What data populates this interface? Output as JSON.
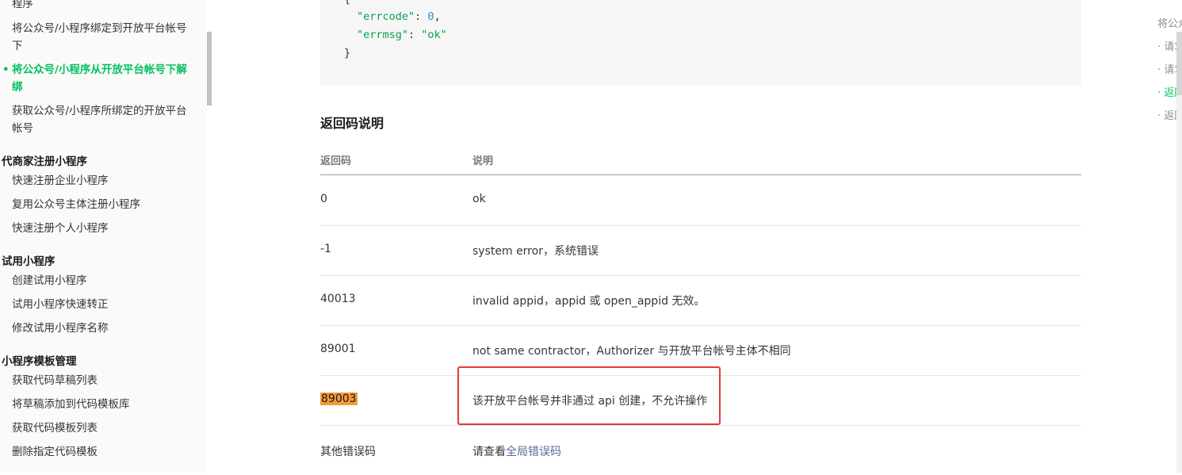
{
  "sidebar": {
    "items": [
      {
        "label": "程序",
        "type": "item"
      },
      {
        "label": "将公众号/小程序绑定到开放平台帐号下",
        "type": "item"
      },
      {
        "label": "将公众号/小程序从开放平台帐号下解绑",
        "type": "active"
      },
      {
        "label": "获取公众号/小程序所绑定的开放平台帐号",
        "type": "item"
      },
      {
        "label": "代商家注册小程序",
        "type": "group"
      },
      {
        "label": "快速注册企业小程序",
        "type": "item"
      },
      {
        "label": "复用公众号主体注册小程序",
        "type": "item"
      },
      {
        "label": "快速注册个人小程序",
        "type": "item"
      },
      {
        "label": "试用小程序",
        "type": "group"
      },
      {
        "label": "创建试用小程序",
        "type": "item"
      },
      {
        "label": "试用小程序快速转正",
        "type": "item"
      },
      {
        "label": "修改试用小程序名称",
        "type": "item"
      },
      {
        "label": "小程序模板管理",
        "type": "group"
      },
      {
        "label": "获取代码草稿列表",
        "type": "item"
      },
      {
        "label": "将草稿添加到代码模板库",
        "type": "item"
      },
      {
        "label": "获取代码模板列表",
        "type": "item"
      },
      {
        "label": "删除指定代码模板",
        "type": "item"
      }
    ]
  },
  "code": {
    "open_brace": "{",
    "key1": "\"errcode\"",
    "val1": "0",
    "key2": "\"errmsg\"",
    "val2": "\"ok\"",
    "close_brace": "}"
  },
  "section_title": "返回码说明",
  "table": {
    "headers": {
      "code": "返回码",
      "desc": "说明"
    },
    "rows": [
      {
        "code": "0",
        "desc": "ok"
      },
      {
        "code": "-1",
        "desc": "system error，系统错误"
      },
      {
        "code": "40013",
        "desc": "invalid appid，appid 或 open_appid 无效。"
      },
      {
        "code": "89001",
        "desc": "not same contractor，Authorizer 与开放平台帐号主体不相同"
      },
      {
        "code": "89003",
        "desc": "该开放平台帐号并非通过 api 创建，不允许操作"
      },
      {
        "code": "其他错误码",
        "desc_prefix": "请查看",
        "desc_link": "全局错误码"
      }
    ]
  },
  "toc": {
    "items": [
      {
        "label": "将公众"
      },
      {
        "label": "· 请求"
      },
      {
        "label": "· 请求"
      },
      {
        "label": "· 返回"
      },
      {
        "label": "· 返回"
      }
    ]
  },
  "colors": {
    "accent": "#07c160",
    "highlight": "#f49b3a",
    "annotation_box": "#e53935",
    "link": "#576b95"
  }
}
